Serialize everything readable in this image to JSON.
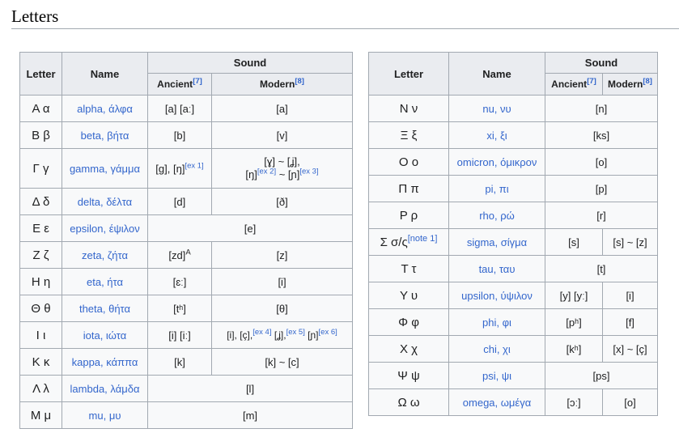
{
  "heading": "Letters",
  "headers": {
    "letter": "Letter",
    "name": "Name",
    "sound": "Sound",
    "ancient": "Ancient",
    "ancient_ref": "[7]",
    "modern": "Modern",
    "modern_ref": "[8]"
  },
  "left_rows": [
    {
      "letter": "Α α",
      "name": "alpha, άλφα",
      "ancient": "[a] [aː]",
      "modern": "[a]"
    },
    {
      "letter": "Β β",
      "name": "beta, βήτα",
      "ancient": "[b]",
      "modern": "[v]"
    },
    {
      "letter": "Γ γ",
      "name": "gamma, γάμμα",
      "ancient": "[g], [ŋ]",
      "ancient_ref": "[ex 1]",
      "modern_l1": "[ɣ] ~ [ʝ],",
      "modern_l2a": "[ŋ]",
      "modern_ref2": "[ex 2]",
      "modern_l2b": " ~ [ɲ]",
      "modern_ref3": "[ex 3]"
    },
    {
      "letter": "Δ δ",
      "name": "delta, δέλτα",
      "ancient": "[d]",
      "modern": "[ð]"
    },
    {
      "letter": "Ε ε",
      "name": "epsilon, έψιλον",
      "sound": "[e]"
    },
    {
      "letter": "Ζ ζ",
      "name": "zeta, ζήτα",
      "ancient": "[zd]",
      "ancient_sup": "A",
      "modern": "[z]"
    },
    {
      "letter": "Η η",
      "name": "eta, ήτα",
      "ancient": "[ɛː]",
      "modern": "[i]"
    },
    {
      "letter": "Θ θ",
      "name": "theta, θήτα",
      "ancient": "[tʰ]",
      "modern": "[θ]"
    },
    {
      "letter": "Ι ι",
      "name": "iota, ιώτα",
      "ancient": "[i] [iː]",
      "modern_a": "[i], [ç],",
      "modern_ref_a": "[ex 4]",
      "modern_b": " [ʝ],",
      "modern_ref_b": "[ex 5]",
      "modern_c": " [ɲ]",
      "modern_ref_c": "[ex 6]"
    },
    {
      "letter": "Κ κ",
      "name": "kappa, κάππα",
      "ancient": "[k]",
      "modern": "[k] ~ [c]"
    },
    {
      "letter": "Λ λ",
      "name": "lambda, λάμδα",
      "sound": "[l]"
    },
    {
      "letter": "Μ μ",
      "name": "mu, μυ",
      "sound": "[m]"
    }
  ],
  "right_rows": [
    {
      "letter": "Ν ν",
      "name": "nu, νυ",
      "sound": "[n]"
    },
    {
      "letter": "Ξ ξ",
      "name": "xi, ξι",
      "sound": "[ks]"
    },
    {
      "letter": "Ο ο",
      "name": "omicron, όμικρον",
      "sound": "[o]"
    },
    {
      "letter": "Π π",
      "name": "pi, πι",
      "sound": "[p]"
    },
    {
      "letter": "Ρ ρ",
      "name": "rho, ρώ",
      "sound": "[r]"
    },
    {
      "letter": "Σ σ/ς",
      "letter_ref": "[note 1]",
      "name": "sigma, σίγμα",
      "ancient": "[s]",
      "modern": "[s] ~ [z]"
    },
    {
      "letter": "Τ τ",
      "name": "tau, ταυ",
      "sound": "[t]"
    },
    {
      "letter": "Υ υ",
      "name": "upsilon, ύψιλον",
      "ancient": "[y] [yː]",
      "modern": "[i]"
    },
    {
      "letter": "Φ φ",
      "name": "phi, φι",
      "ancient": "[pʰ]",
      "modern": "[f]"
    },
    {
      "letter": "Χ χ",
      "name": "chi, χι",
      "ancient": "[kʰ]",
      "modern": "[x] ~ [ç]"
    },
    {
      "letter": "Ψ ψ",
      "name": "psi, ψι",
      "sound": "[ps]"
    },
    {
      "letter": "Ω ω",
      "name": "omega, ωμέγα",
      "ancient": "[ɔː]",
      "modern": "[o]"
    }
  ]
}
